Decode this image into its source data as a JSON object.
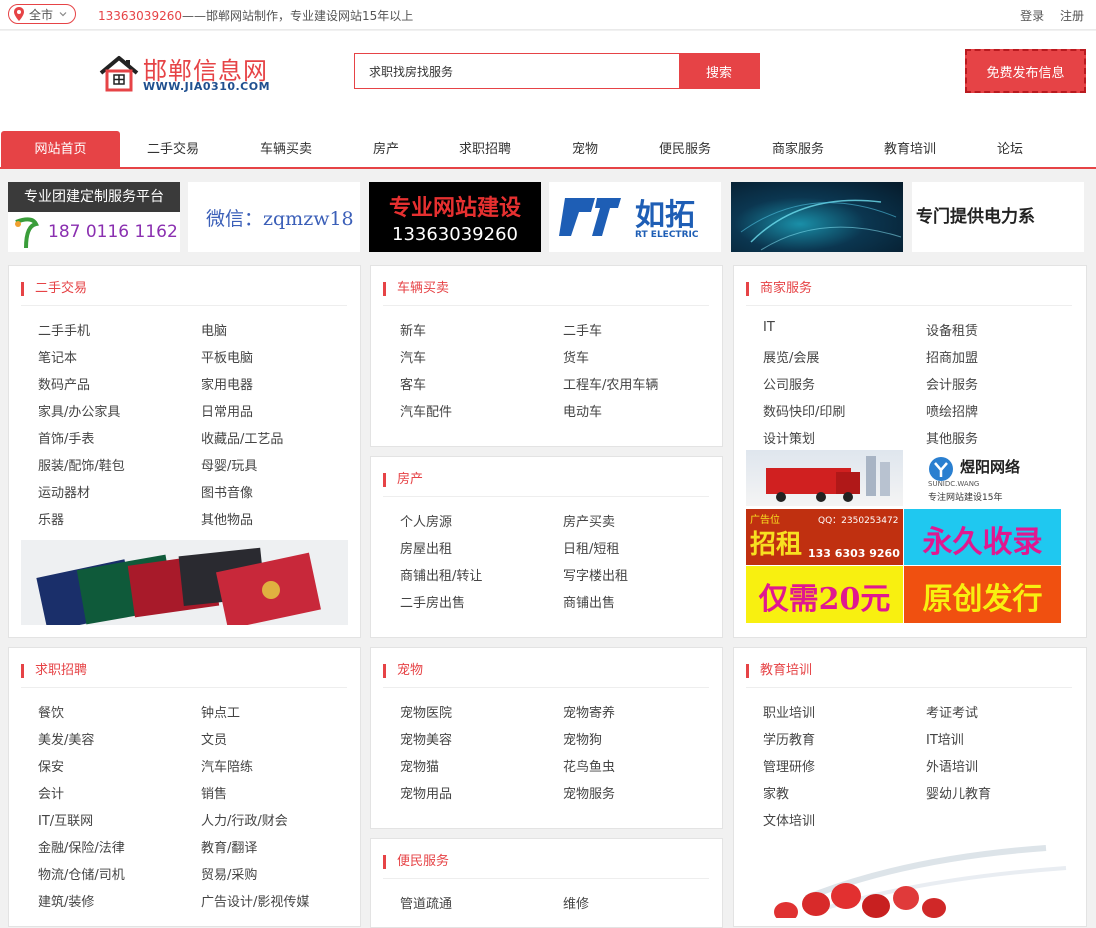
{
  "topbar": {
    "city": "全市",
    "phone": "13363039260",
    "slogan": "——邯郸网站制作，专业建设网站15年以上",
    "login": "登录",
    "register": "注册"
  },
  "logo": {
    "brand": "邯郸信息网",
    "url": "WWW.JIA0310.COM"
  },
  "search": {
    "value": "求职找房找服务",
    "button": "搜索"
  },
  "publish_label": "免费发布信息",
  "nav": [
    "网站首页",
    "二手交易",
    "车辆买卖",
    "房产",
    "求职招聘",
    "宠物",
    "便民服务",
    "商家服务",
    "教育培训",
    "论坛"
  ],
  "ads": {
    "a1_l1": "专业团建定制服务平台",
    "a1_l2": "187 0116 1162",
    "a2": "微信：zqmzw18",
    "a3_l1": "专业网站建设",
    "a3_l2": "13363039260",
    "a4_l1": "如拓",
    "a4_l2": "RT ELECTRIC",
    "a6": "专门提供电力系",
    "m1_brand": "煜阳网络",
    "m1_url": "SUNIDC.WANG",
    "m1_tag": "专注网站建设15年",
    "m2_l1": "广告位",
    "m2_qq": "QQ：2350253472",
    "m2_big": "招租",
    "m2_phone": "133 6303 9260",
    "m3": "永久收录",
    "m4": "仅需20元",
    "m5": "原创发行"
  },
  "panels": {
    "ershou": {
      "title": "二手交易",
      "items": [
        "二手手机",
        "电脑",
        "笔记本",
        "平板电脑",
        "数码产品",
        "家用电器",
        "家具/办公家具",
        "日常用品",
        "首饰/手表",
        "收藏品/工艺品",
        "服装/配饰/鞋包",
        "母婴/玩具",
        "运动器材",
        "图书音像",
        "乐器",
        "其他物品"
      ]
    },
    "cheliang": {
      "title": "车辆买卖",
      "items": [
        "新车",
        "二手车",
        "汽车",
        "货车",
        "客车",
        "工程车/农用车辆",
        "汽车配件",
        "电动车"
      ]
    },
    "fangchan": {
      "title": "房产",
      "items": [
        "个人房源",
        "房产买卖",
        "房屋出租",
        "日租/短租",
        "商铺出租/转让",
        "写字楼出租",
        "二手房出售",
        "商铺出售"
      ]
    },
    "shangjia": {
      "title": "商家服务",
      "items": [
        "IT",
        "设备租赁",
        "展览/会展",
        "招商加盟",
        "公司服务",
        "会计服务",
        "数码快印/印刷",
        "喷绘招牌",
        "设计策划",
        "其他服务"
      ]
    },
    "qiuzhi": {
      "title": "求职招聘",
      "items": [
        "餐饮",
        "钟点工",
        "美发/美容",
        "文员",
        "保安",
        "汽车陪练",
        "会计",
        "销售",
        "IT/互联网",
        "人力/行政/财会",
        "金融/保险/法律",
        "教育/翻译",
        "物流/仓储/司机",
        "贸易/采购",
        "建筑/装修",
        "广告设计/影视传媒"
      ]
    },
    "chongwu": {
      "title": "宠物",
      "items": [
        "宠物医院",
        "宠物寄养",
        "宠物美容",
        "宠物狗",
        "宠物猫",
        "花鸟鱼虫",
        "宠物用品",
        "宠物服务"
      ]
    },
    "bianmin": {
      "title": "便民服务",
      "items": [
        "管道疏通",
        "维修"
      ]
    },
    "jiaoyu": {
      "title": "教育培训",
      "items": [
        "职业培训",
        "考证考试",
        "学历教育",
        "IT培训",
        "管理研修",
        "外语培训",
        "家教",
        "婴幼儿教育",
        "文体培训"
      ]
    }
  },
  "colors": {
    "accent": "#e64346"
  }
}
